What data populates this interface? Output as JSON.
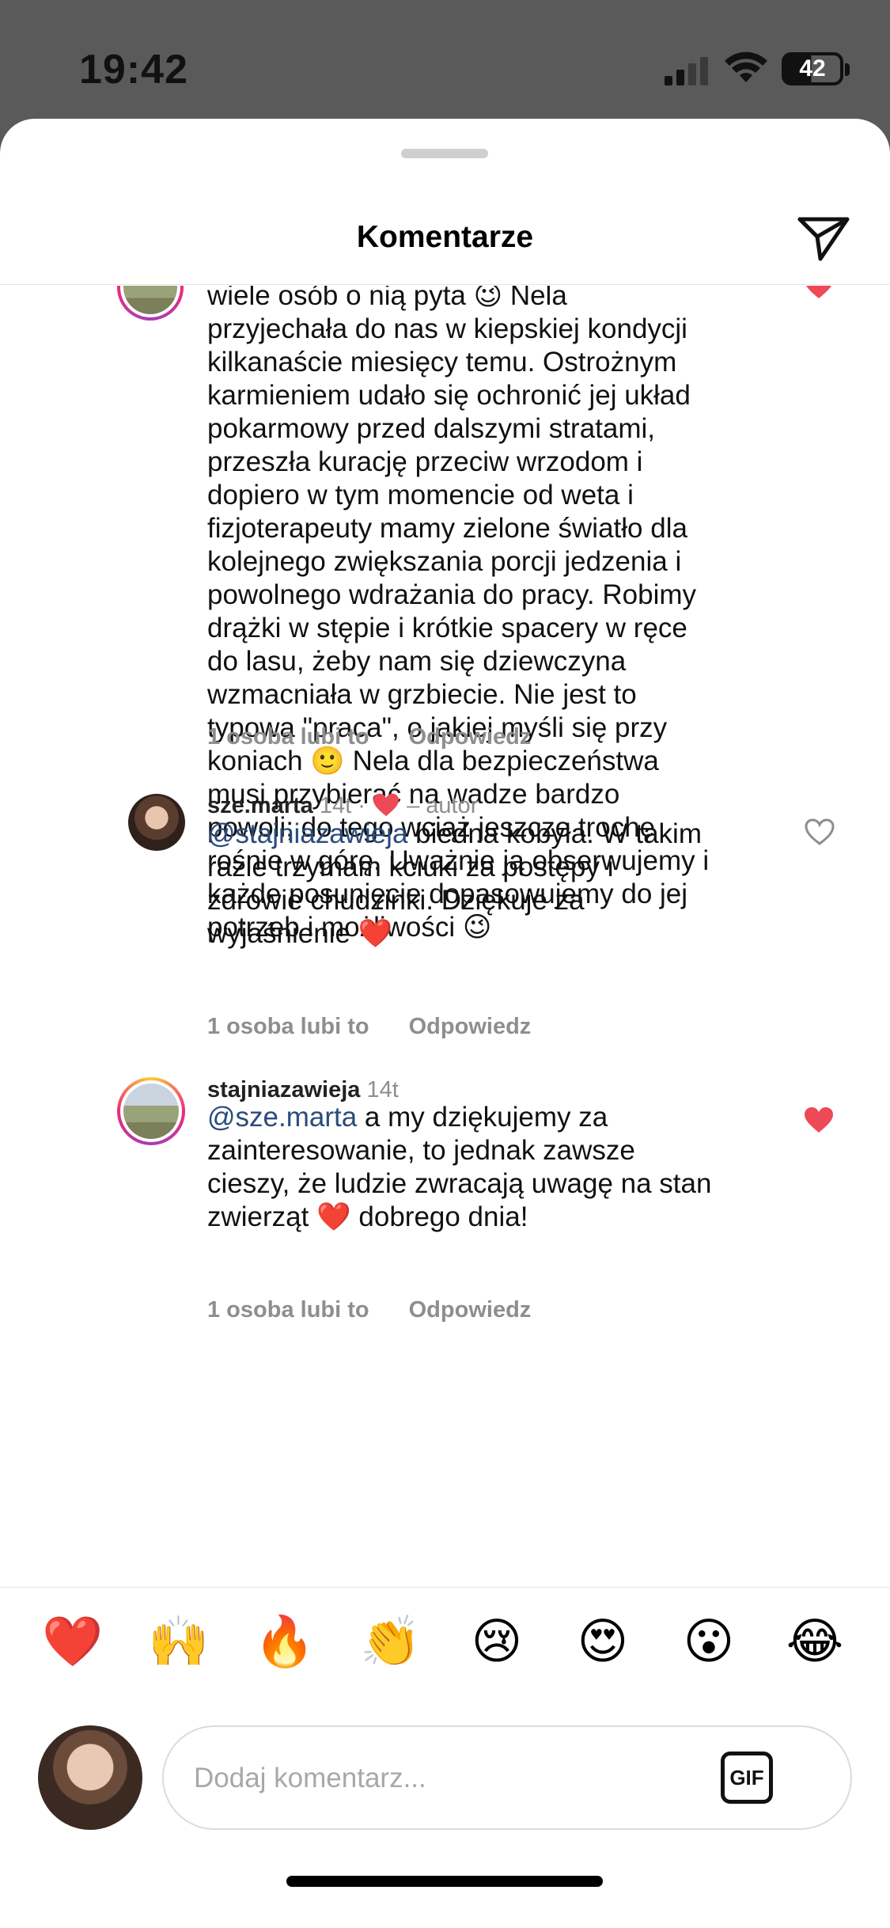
{
  "status_bar": {
    "time": "19:42",
    "battery": "42"
  },
  "header": {
    "title": "Komentarze"
  },
  "comments": [
    {
      "id": "c1",
      "lines": [
        "wiele osób o nią pyta 😉 Nela",
        "przyjechała do nas w kiepskiej kondycji",
        "kilkanaście miesięcy temu. Ostrożnym",
        "karmieniem udało się ochronić jej układ",
        "pokarmowy przed dalszymi stratami,",
        "przeszła kurację przeciw wrzodom i",
        "dopiero w tym momencie od weta i",
        "fizjoterapeuty mamy zielone światło dla",
        "kolejnego zwiększania porcji jedzenia i",
        "powolnego wdrażania do pracy. Robimy",
        "drążki w stępie i krótkie spacery w ręce",
        "do lasu, żeby nam się dziewczyna",
        "wzmacniała w grzbiecie. Nie jest to",
        "typowa \"praca\", o jakiej myśli się przy",
        "koniach 🙂 Nela dla bezpieczeństwa",
        "musi przybierać na wadze bardzo",
        "powoli; do tego wciąż jeszcze trochę",
        "rośnie w górę. Uważnie ją obserwujemy i",
        "każde posunięcie dopasowujemy do jej",
        "potrzeb i możliwości 😉"
      ],
      "likes": "1 osoba lubi to",
      "reply": "Odpowiedz"
    },
    {
      "id": "c2",
      "username": "sze.marta",
      "age": "14t",
      "separator": "·",
      "author_label": "– autor",
      "mention": "@stajniazawieja",
      "lines": [
        " biedna kobyła. W takim",
        "razie trzymam kciuki za postępy i",
        "zdrowie chudzinki. Dziękuje za",
        "wyjaśnienie ❤️"
      ],
      "likes": "1 osoba lubi to",
      "reply": "Odpowiedz"
    },
    {
      "id": "c3",
      "username": "stajniazawieja",
      "age": "14t",
      "mention": "@sze.marta",
      "lines": [
        " a my dziękujemy za",
        "zainteresowanie, to jednak zawsze",
        "cieszy, że ludzie zwracają uwagę na stan",
        "zwierząt ❤️ dobrego dnia!"
      ],
      "likes": "1 osoba lubi to",
      "reply": "Odpowiedz"
    }
  ],
  "reactions": [
    "❤️",
    "🙌",
    "🔥",
    "👏",
    "😢",
    "😍",
    "😮",
    "😂"
  ],
  "composer": {
    "placeholder": "Dodaj komentarz...",
    "gif_label": "GIF"
  },
  "colors": {
    "like_red": "#ed4956",
    "mention_blue": "#2a4b7c",
    "muted": "#8e8e8e"
  }
}
